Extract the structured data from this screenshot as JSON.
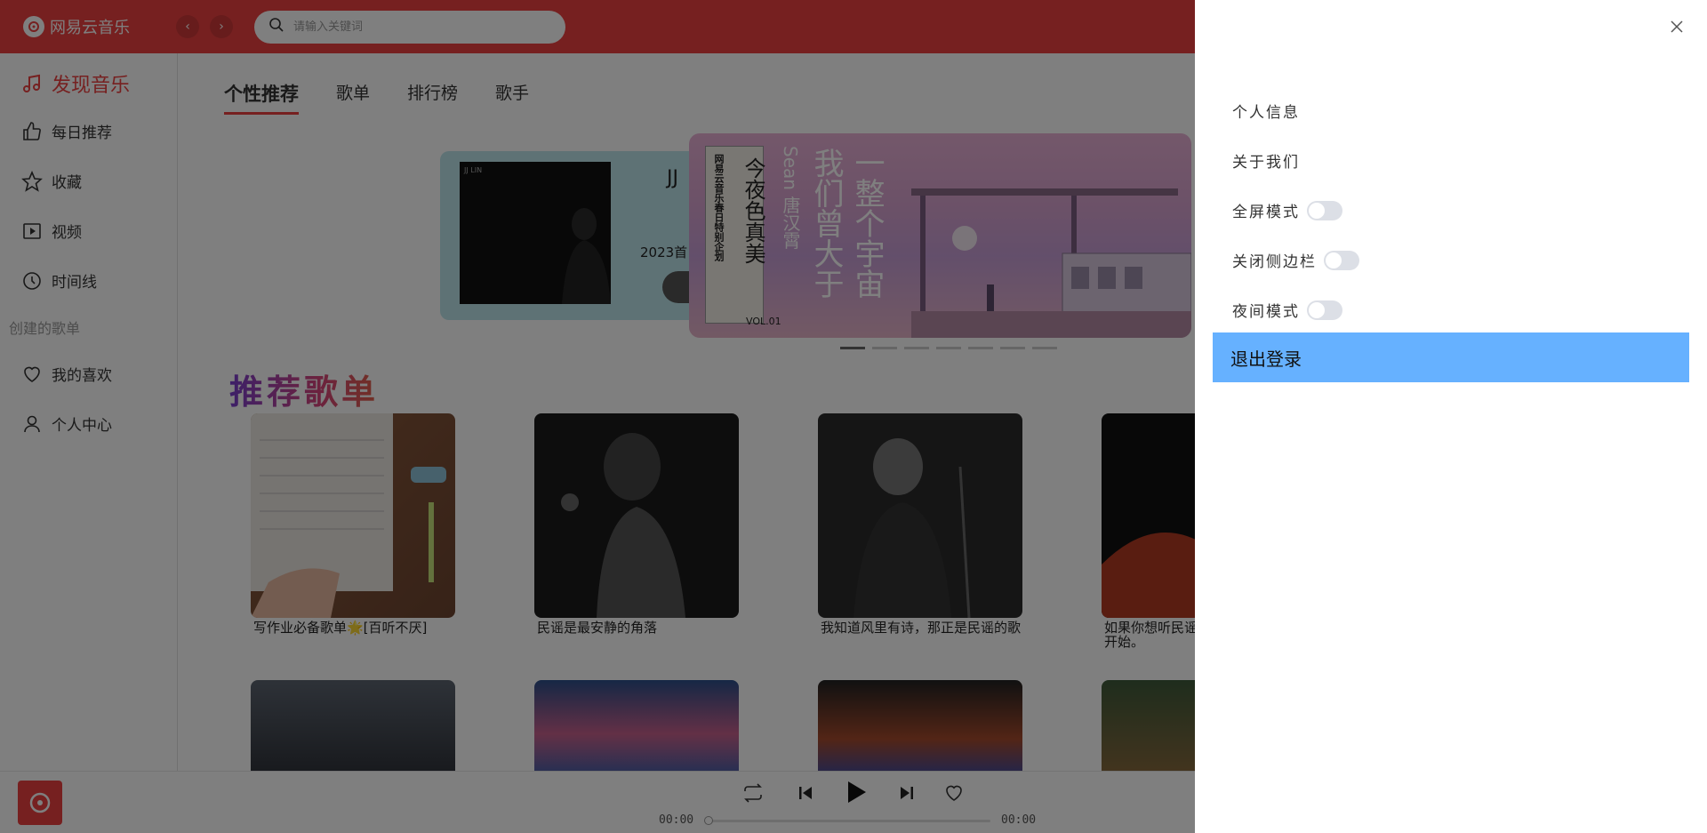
{
  "header": {
    "app_name": "网易云音乐",
    "back_icon": "chevron-left-icon",
    "forward_icon": "chevron-right-icon",
    "search_placeholder": "请输入关键词",
    "brand_color": "#ec4141"
  },
  "sidebar": {
    "items": [
      {
        "label": "发现音乐",
        "icon": "music-note-icon",
        "active": true
      },
      {
        "label": "每日推荐",
        "icon": "thumbs-up-icon"
      },
      {
        "label": "收藏",
        "icon": "star-icon"
      },
      {
        "label": "视频",
        "icon": "video-icon"
      },
      {
        "label": "时间线",
        "icon": "clock-icon"
      }
    ],
    "section_label": "创建的歌单",
    "playlist_items": [
      {
        "label": "我的喜欢",
        "icon": "heart-icon"
      },
      {
        "label": "个人中心",
        "icon": "user-icon"
      }
    ]
  },
  "main": {
    "tabs": [
      "个性推荐",
      "歌单",
      "排行榜",
      "歌手"
    ],
    "active_tab": "个性推荐",
    "banner_left": {
      "cover_label": "JJ LIN",
      "title": "JJ",
      "subtitle": "2023首"
    },
    "banner_main": {
      "panel_title": "今夜色真美",
      "panel_sub": "网易云音乐春日特别企划",
      "panel_vol": "VOL.01",
      "artist": "Sean 唐汉霄",
      "song": "一整个宇宙",
      "song2": "我们曾大于"
    },
    "section_title": "推荐歌单",
    "playlists_row1": [
      {
        "name": "写作业必备歌单🌟[百听不厌]"
      },
      {
        "name": "民谣是最安静的角落"
      },
      {
        "name": "我知道风里有诗，那正是民谣的歌"
      },
      {
        "name": "如果你想听民谣，可以从这些歌曲开始。"
      }
    ]
  },
  "player": {
    "current_time": "00:00",
    "total_time": "00:00",
    "progress": 0,
    "loop_icon": "repeat-icon",
    "prev_icon": "skip-back-icon",
    "play_icon": "play-icon",
    "next_icon": "skip-forward-icon",
    "like_icon": "heart-icon"
  },
  "drawer": {
    "close_icon": "close-icon",
    "items": [
      {
        "label": "个人信息"
      },
      {
        "label": "关于我们"
      },
      {
        "label": "全屏模式",
        "toggle": false
      },
      {
        "label": "关闭侧边栏",
        "toggle": false
      },
      {
        "label": "夜间模式",
        "toggle": false
      }
    ],
    "logout_label": "退出登录",
    "logout_color": "#66b1ff"
  }
}
